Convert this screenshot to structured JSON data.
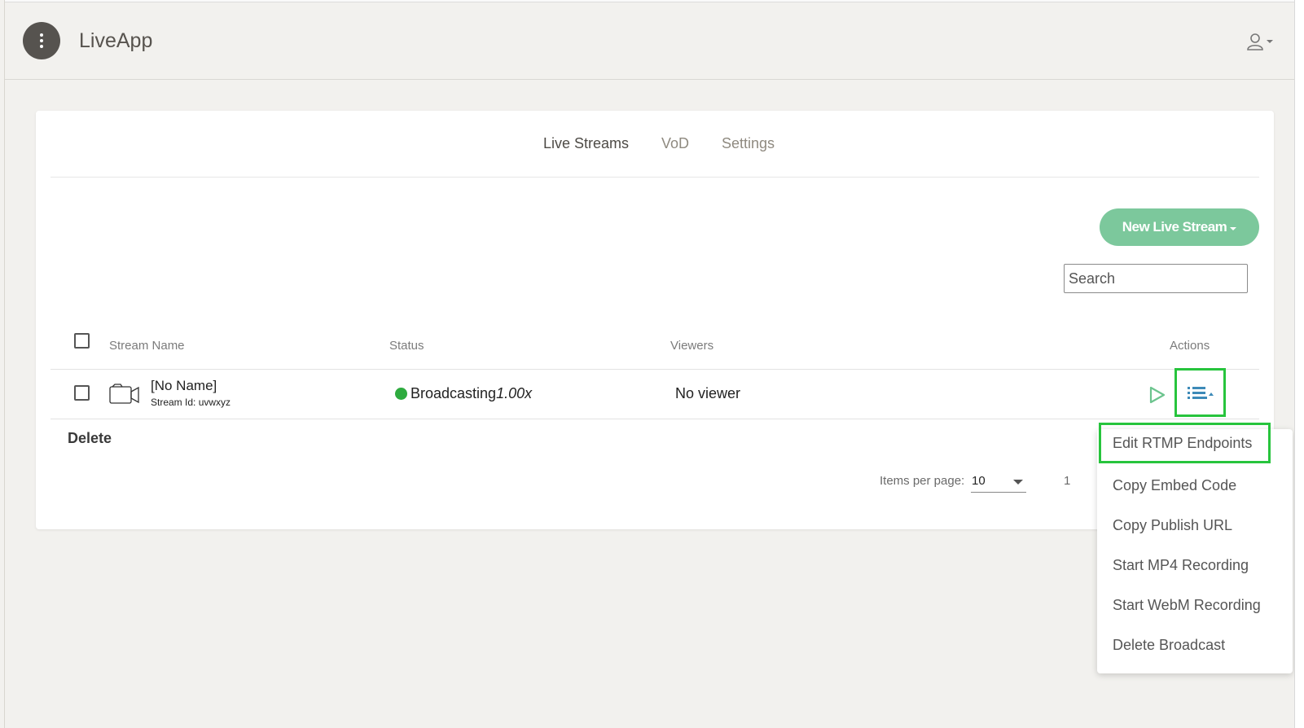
{
  "app": {
    "title": "LiveApp"
  },
  "header": {
    "menu_icon": "vertical-dots-icon",
    "user_icon": "user-icon"
  },
  "tabs": [
    {
      "label": "Live Streams",
      "active": true
    },
    {
      "label": "VoD",
      "active": false
    },
    {
      "label": "Settings",
      "active": false
    }
  ],
  "toolbar": {
    "new_stream_label": "New Live Stream",
    "search_placeholder": "Search"
  },
  "table": {
    "headers": {
      "stream_name": "Stream Name",
      "status": "Status",
      "viewers": "Viewers",
      "actions": "Actions"
    },
    "rows": [
      {
        "name": "[No Name]",
        "stream_id_label": "Stream Id: uvwxyz",
        "status": "Broadcasting",
        "rate": "1.00x",
        "status_color": "#2eab3f",
        "viewers": "No viewer"
      }
    ]
  },
  "footer": {
    "delete_label": "Delete",
    "items_per_page_label": "Items per page:",
    "items_per_page_value": "10",
    "page_number": "1"
  },
  "actions_menu": {
    "items": [
      {
        "label": "Edit RTMP Endpoints",
        "highlighted": true
      },
      {
        "label": "Copy Embed Code"
      },
      {
        "label": "Copy Publish URL"
      },
      {
        "label": "Start MP4 Recording"
      },
      {
        "label": "Start WebM Recording"
      },
      {
        "label": "Delete Broadcast"
      }
    ]
  },
  "colors": {
    "accent": "#7cc89c",
    "highlight": "#27c43d",
    "header_bg": "#f2f1ee",
    "play_green": "#6cc48e",
    "menu_blue": "#3d8ab8"
  }
}
